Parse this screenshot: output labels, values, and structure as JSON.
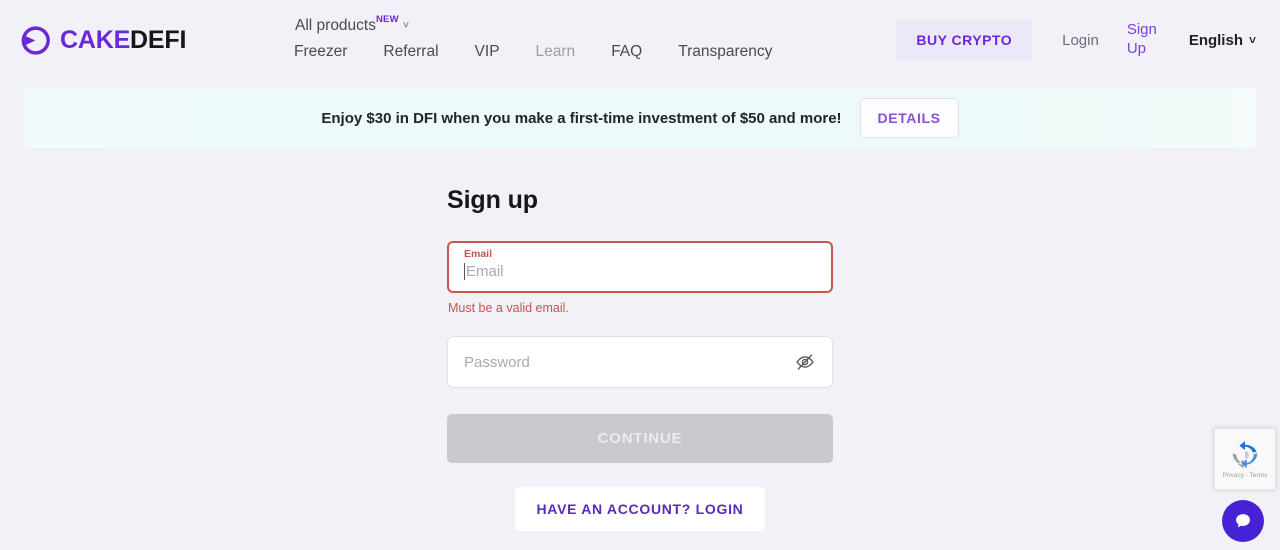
{
  "brand": {
    "name_part1": "CAKE",
    "name_part2": "DEFI",
    "logo_icon": "cakedefi-logo-icon",
    "accent_purple": "#6a29d9"
  },
  "nav": {
    "all_products": "All products",
    "new_badge": "NEW",
    "dropdown_icon": "chevron-down-icon",
    "items": [
      {
        "label": "Freezer",
        "muted": false
      },
      {
        "label": "Referral",
        "muted": false
      },
      {
        "label": "VIP",
        "muted": false
      },
      {
        "label": "Learn",
        "muted": true
      },
      {
        "label": "FAQ",
        "muted": false
      },
      {
        "label": "Transparency",
        "muted": false
      }
    ]
  },
  "header_actions": {
    "buy_crypto": "BUY CRYPTO",
    "login": "Login",
    "sign_up": "Sign Up",
    "language": "English",
    "language_chevron_icon": "chevron-down-icon"
  },
  "banner": {
    "text": "Enjoy $30 in DFI when you make a first-time investment of $50 and more!",
    "details_button": "DETAILS",
    "background_start": "#f2fbfb",
    "background_end": "#f4fbfa"
  },
  "form": {
    "title": "Sign up",
    "email": {
      "label": "Email",
      "placeholder": "Email",
      "value": "",
      "error": "Must be a valid email.",
      "error_color": "#c2564f",
      "border_color": "#c9564f",
      "focused": true
    },
    "password": {
      "placeholder": "Password",
      "value": "",
      "toggle_icon": "eye-off-icon"
    },
    "continue_button": {
      "label": "CONTINUE",
      "disabled": true,
      "background": "#c8c8ce"
    },
    "login_button": {
      "label": "HAVE AN ACCOUNT? LOGIN",
      "color": "#5b2bb8"
    }
  },
  "recaptcha": {
    "privacy_terms": "Privacy - Terms",
    "icon": "recaptcha-icon"
  },
  "chat": {
    "icon": "chat-bubble-icon",
    "color": "#4622d4"
  }
}
